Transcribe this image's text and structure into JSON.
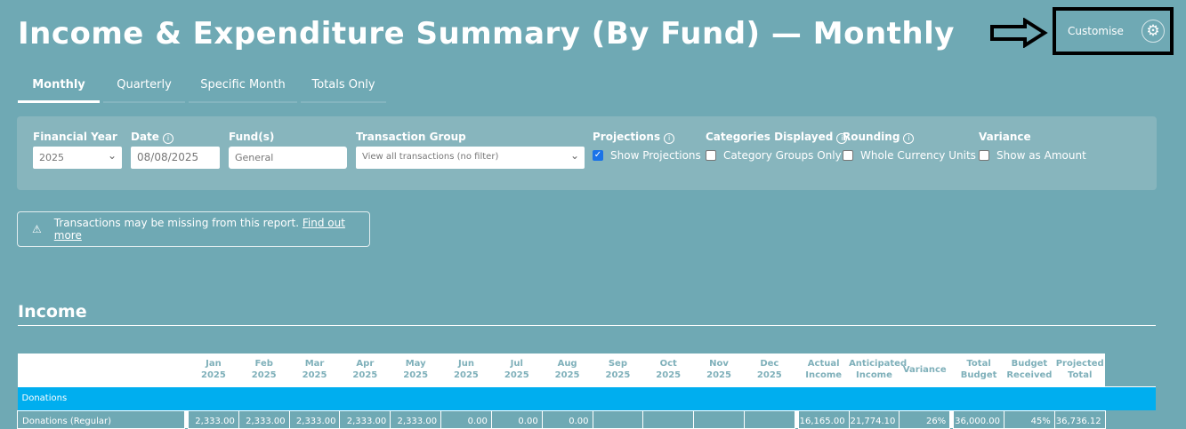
{
  "title": "Income & Expenditure Summary (By Fund) — Monthly",
  "customise": {
    "label": "Customise"
  },
  "tabs": [
    "Monthly",
    "Quarterly",
    "Specific Month",
    "Totals Only"
  ],
  "filters": {
    "financial_year": {
      "label": "Financial Year",
      "value": "2025"
    },
    "date": {
      "label": "Date",
      "value": "08/08/2025"
    },
    "funds": {
      "label": "Fund(s)",
      "value": "General"
    },
    "transaction_group": {
      "label": "Transaction Group",
      "value": "View all transactions (no filter)"
    },
    "projections": {
      "label": "Projections",
      "option": "Show Projections",
      "checked": true
    },
    "categories": {
      "label": "Categories Displayed",
      "option": "Category Groups Only",
      "checked": false
    },
    "rounding": {
      "label": "Rounding",
      "option": "Whole Currency Units",
      "checked": false
    },
    "variance": {
      "label": "Variance",
      "option": "Show as Amount",
      "checked": false
    }
  },
  "warning": {
    "text": "Transactions may be missing from this report.",
    "link": "Find out more"
  },
  "section": "Income",
  "table": {
    "months": [
      [
        "Jan",
        "2025"
      ],
      [
        "Feb",
        "2025"
      ],
      [
        "Mar",
        "2025"
      ],
      [
        "Apr",
        "2025"
      ],
      [
        "May",
        "2025"
      ],
      [
        "Jun",
        "2025"
      ],
      [
        "Jul",
        "2025"
      ],
      [
        "Aug",
        "2025"
      ],
      [
        "Sep",
        "2025"
      ],
      [
        "Oct",
        "2025"
      ],
      [
        "Nov",
        "2025"
      ],
      [
        "Dec",
        "2025"
      ]
    ],
    "totals_headers": [
      [
        "Actual",
        "Income"
      ],
      [
        "Anticipated",
        "Income"
      ],
      [
        "Variance",
        ""
      ]
    ],
    "budget_headers": [
      [
        "Total",
        "Budget"
      ],
      [
        "Budget",
        "Received"
      ],
      [
        "Projected",
        "Total"
      ]
    ],
    "group": "Donations",
    "row": {
      "label": "Donations (Regular)",
      "months": [
        "2,333.00",
        "2,333.00",
        "2,333.00",
        "2,333.00",
        "2,333.00",
        "0.00",
        "0.00",
        "0.00",
        "",
        "",
        "",
        ""
      ],
      "totals": [
        "16,165.00",
        "21,774.10",
        "26%"
      ],
      "budget": [
        "36,000.00",
        "45%",
        "36,736.12"
      ]
    }
  }
}
